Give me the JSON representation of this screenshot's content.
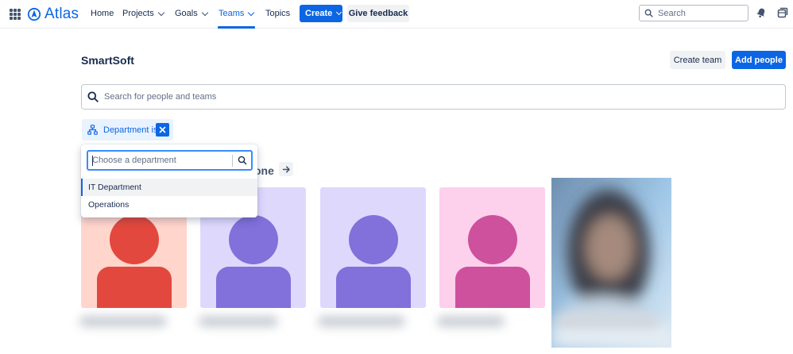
{
  "nav": {
    "brand": "Atlas",
    "items": [
      {
        "label": "Home"
      },
      {
        "label": "Projects"
      },
      {
        "label": "Goals"
      },
      {
        "label": "Teams"
      },
      {
        "label": "Topics"
      }
    ],
    "create_label": "Create",
    "feedback_label": "Give feedback",
    "search_placeholder": "Search"
  },
  "page": {
    "title": "SmartSoft",
    "create_team_label": "Create team",
    "add_people_label": "Add people",
    "search_placeholder": "Search for people and teams"
  },
  "filter": {
    "chip_label": "Department is",
    "dropdown": {
      "placeholder": "Choose a department",
      "options": [
        "IT Department",
        "Operations"
      ],
      "selected": "IT Department"
    }
  },
  "section": {
    "heading_visible": "one"
  },
  "colors": {
    "brand_blue": "#0c66e4",
    "card_1_bg": "#ffd5cc",
    "card_1_fg": "#e2483d",
    "card_2_bg": "#dfd8fd",
    "card_2_fg": "#8270db",
    "card_3_bg": "#dfd8fd",
    "card_3_fg": "#8270db",
    "card_4_bg": "#fdd0ec",
    "card_4_fg": "#cd519d"
  },
  "icons": {
    "app_switcher": "grid-icon",
    "notifications": "bell-icon",
    "switch_view": "window-icon",
    "search": "search-icon",
    "department": "org-chart-icon",
    "clear": "close-icon",
    "next": "arrow-right-icon"
  }
}
